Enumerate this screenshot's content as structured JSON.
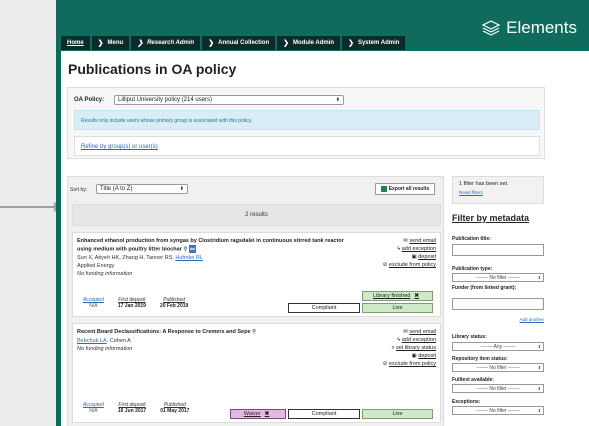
{
  "brand": {
    "name": "Elements"
  },
  "nav": [
    {
      "label": "Home"
    },
    {
      "label": "Menu"
    },
    {
      "label": "Research Admin"
    },
    {
      "label": "Annual Collection"
    },
    {
      "label": "Module Admin"
    },
    {
      "label": "System Admin"
    }
  ],
  "page": {
    "title": "Publications in OA policy"
  },
  "oa": {
    "label": "OA Policy:",
    "selected": "Lilliput University policy (214 users)",
    "info": "Results only include users whose primary group is associated with this policy.",
    "refine": "Refine by group(s) or user(s)"
  },
  "results": {
    "sort_label": "Sort by:",
    "sort_value": "Title (A to Z)",
    "export_label": "Export all results",
    "count": "2 results"
  },
  "publications": [
    {
      "title": "Enhanced ethanol production from syngas by Clostridium ragsdalei in continuous stirred tank reactor using medium with poultry litter biochar",
      "doi_badge": "doi",
      "authors_prefix": "Sun X, Atiyeh HK, Zhang H, Tanner RS, ",
      "authors_link": "Huhnke RL",
      "journal": "Applied Energy",
      "funding": "No funding information",
      "actions": [
        "send email",
        "add exception",
        "deposit",
        "exclude from policy"
      ],
      "dates": {
        "accepted_label": "Accepted",
        "accepted": "N/A",
        "first_deposit_label": "First deposit",
        "first_deposit": "17 Jan 2019",
        "published_label": "Published",
        "published": "20 Feb 2019"
      },
      "statuses": {
        "library": "Library finished",
        "compliance": "Compliant",
        "live": "Live"
      }
    },
    {
      "title": "Recent Board Declassifications: A Response to Cremers and Sepe",
      "authors_link": "Bebchuk LA",
      "authors_suffix": ", Cohen A",
      "funding": "No funding information",
      "actions": [
        "send email",
        "add exception",
        "set library status",
        "deposit",
        "exclude from policy"
      ],
      "dates": {
        "accepted_label": "Accepted",
        "accepted": "N/A",
        "first_deposit_label": "First deposit",
        "first_deposit": "16 Jun 2017",
        "published_label": "Published",
        "published": "01 May 2017"
      },
      "statuses": {
        "waiver": "Waiver",
        "compliance": "Compliant",
        "live": "Live"
      }
    }
  ],
  "sidebar": {
    "filter_count": "1 filter has been set.",
    "reset": "Reset filters",
    "heading": "Filter by metadata",
    "pub_title_label": "Publication title:",
    "pub_type_label": "Publication type:",
    "pub_type_value": "------- No filter -------",
    "funder_label": "Funder (from linked grant):",
    "add_another": "Add another",
    "library_status_label": "Library status:",
    "library_status_value": "------- Any -------",
    "repo_status_label": "Repository item status:",
    "repo_status_value": "------- No filter -------",
    "fulltext_label": "Fulltext available:",
    "fulltext_value": "------- No filter -------",
    "exceptions_label": "Exceptions:",
    "exceptions_value": "------- No filter -------"
  },
  "colors": {
    "header": "#0f6b5c",
    "nav_tab": "#0b2c2a",
    "link": "#2a6bb7",
    "live": "#cfe8c8",
    "waiver": "#e1b9e4"
  }
}
